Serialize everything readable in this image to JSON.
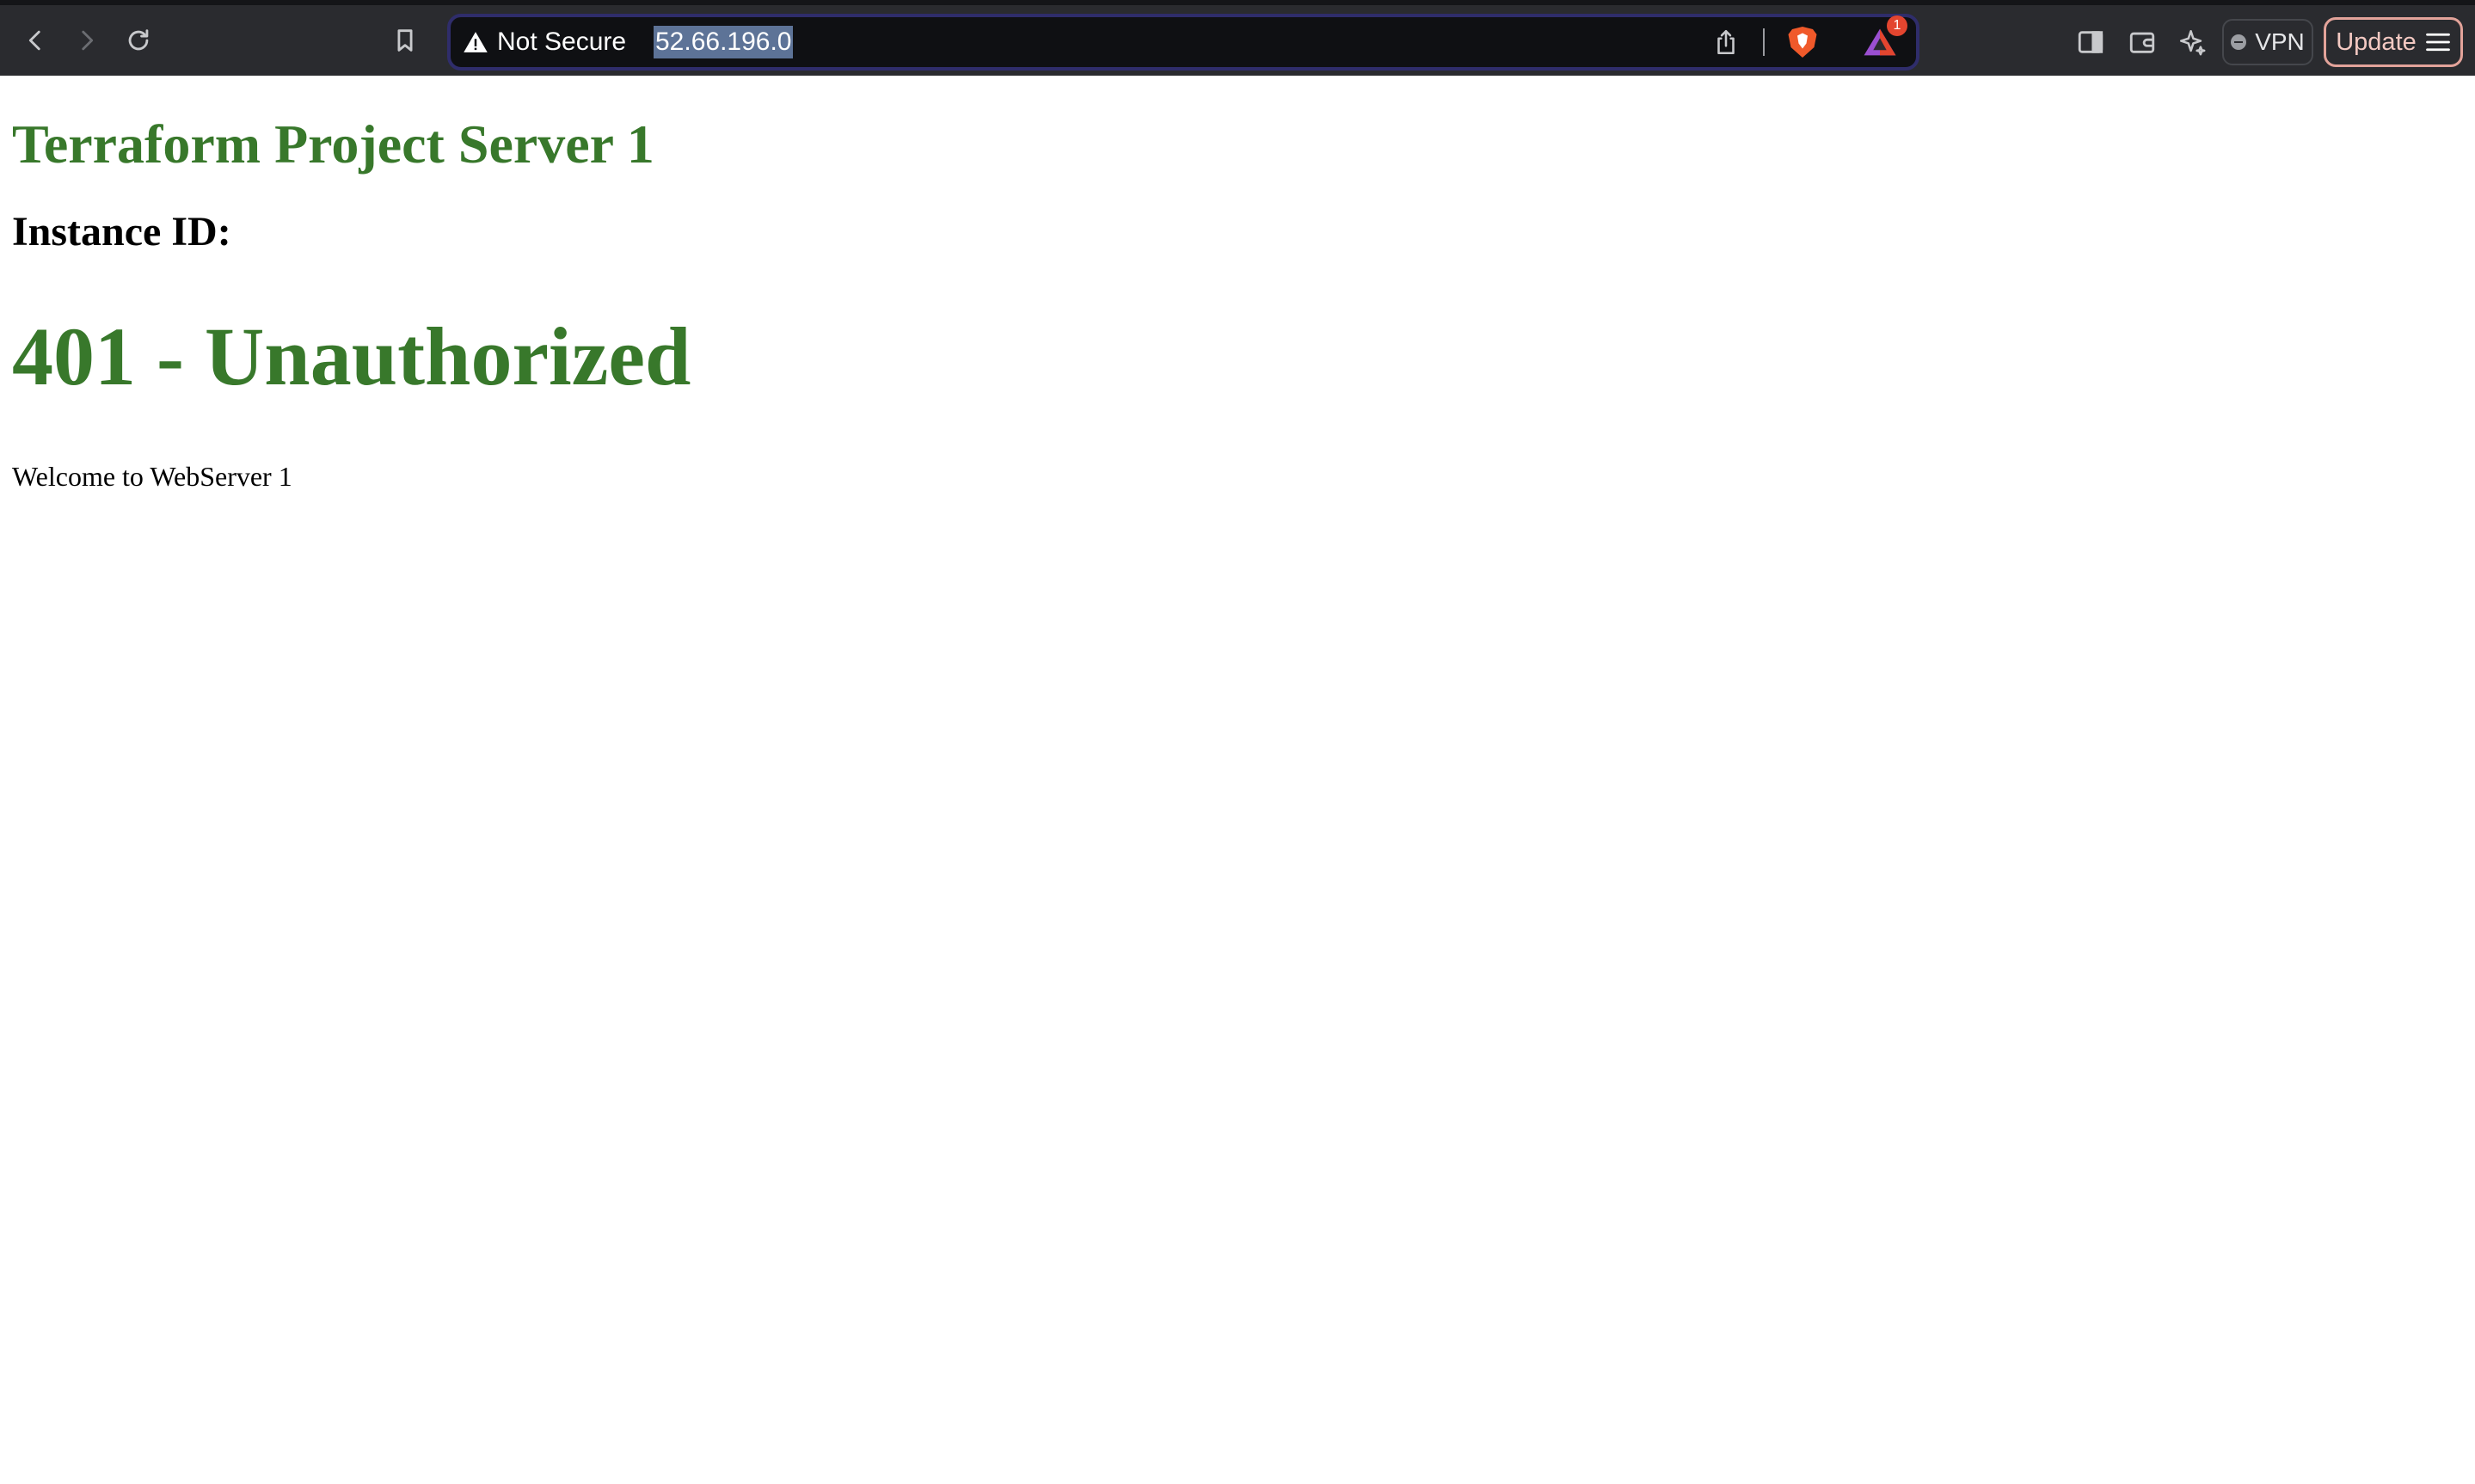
{
  "browser": {
    "security_label": "Not Secure",
    "url": "52.66.196.0",
    "rewards_badge_count": "1",
    "vpn_label": "VPN",
    "update_label": "Update",
    "icons": {
      "back": "chevron-left-icon",
      "forward": "chevron-right-icon",
      "reload": "reload-icon",
      "bookmark": "bookmark-icon",
      "warning": "warning-icon",
      "share": "share-icon",
      "shield": "brave-shield-icon",
      "rewards": "rewards-triangle-icon",
      "sidebar": "sidebar-icon",
      "wallet": "wallet-icon",
      "leo": "sparkle-icon",
      "menu": "hamburger-menu-icon"
    },
    "colors": {
      "toolbar": "#2a2b2f",
      "urlbar": "#0f1013",
      "url_selection": "#5d7397",
      "update_accent": "#e3a39a"
    }
  },
  "page": {
    "title": "Terraform Project Server 1",
    "instance_label": "Instance ID:",
    "error_heading": "401 - Unauthorized",
    "welcome_text": "Welcome to WebServer 1",
    "colors": {
      "heading_green": "#38782b",
      "text": "#000000",
      "background": "#ffffff"
    }
  }
}
